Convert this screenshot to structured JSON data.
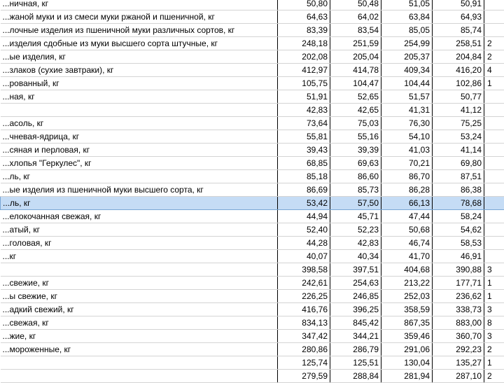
{
  "rows": [
    {
      "name": "...ничная, кг",
      "v1": "50,80",
      "v2": "50,48",
      "v3": "51,05",
      "v4": "50,91",
      "v5": ""
    },
    {
      "name": "...жаной муки и из смеси муки ржаной и пшеничной, кг",
      "v1": "64,63",
      "v2": "64,02",
      "v3": "63,84",
      "v4": "64,93",
      "v5": ""
    },
    {
      "name": "...лочные изделия из пшеничной муки различных сортов, кг",
      "v1": "83,39",
      "v2": "83,54",
      "v3": "85,05",
      "v4": "85,74",
      "v5": ""
    },
    {
      "name": "...изделия сдобные из муки высшего сорта штучные, кг",
      "v1": "248,18",
      "v2": "251,59",
      "v3": "254,99",
      "v4": "258,51",
      "v5": "2"
    },
    {
      "name": "...ые изделия, кг",
      "v1": "202,08",
      "v2": "205,04",
      "v3": "205,37",
      "v4": "204,84",
      "v5": "2"
    },
    {
      "name": "...злаков (сухие завтраки), кг",
      "v1": "412,97",
      "v2": "414,78",
      "v3": "409,34",
      "v4": "416,20",
      "v5": "4"
    },
    {
      "name": "...рованный, кг",
      "v1": "105,75",
      "v2": "104,47",
      "v3": "104,44",
      "v4": "102,86",
      "v5": "1"
    },
    {
      "name": "...ная, кг",
      "v1": "51,91",
      "v2": "52,65",
      "v3": "51,57",
      "v4": "50,77",
      "v5": ""
    },
    {
      "name": "",
      "v1": "42,83",
      "v2": "42,65",
      "v3": "41,31",
      "v4": "41,12",
      "v5": ""
    },
    {
      "name": "...асоль, кг",
      "v1": "73,64",
      "v2": "75,03",
      "v3": "76,30",
      "v4": "75,25",
      "v5": ""
    },
    {
      "name": "...чневая-ядрица, кг",
      "v1": "55,81",
      "v2": "55,16",
      "v3": "54,10",
      "v4": "53,24",
      "v5": ""
    },
    {
      "name": "...сяная и перловая, кг",
      "v1": "39,43",
      "v2": "39,39",
      "v3": "41,03",
      "v4": "41,14",
      "v5": ""
    },
    {
      "name": "...хлопья \"Геркулес\", кг",
      "v1": "68,85",
      "v2": "69,63",
      "v3": "70,21",
      "v4": "69,80",
      "v5": ""
    },
    {
      "name": "...ль, кг",
      "v1": "85,18",
      "v2": "86,60",
      "v3": "86,70",
      "v4": "87,51",
      "v5": ""
    },
    {
      "name": "...ые изделия из пшеничной муки высшего сорта, кг",
      "v1": "86,69",
      "v2": "85,73",
      "v3": "86,28",
      "v4": "86,38",
      "v5": ""
    },
    {
      "name": "...ль, кг",
      "v1": "53,42",
      "v2": "57,50",
      "v3": "66,13",
      "v4": "78,68",
      "v5": "",
      "selected": true
    },
    {
      "name": "...елокочанная свежая, кг",
      "v1": "44,94",
      "v2": "45,71",
      "v3": "47,44",
      "v4": "58,24",
      "v5": ""
    },
    {
      "name": "...атый, кг",
      "v1": "52,40",
      "v2": "52,23",
      "v3": "50,68",
      "v4": "54,62",
      "v5": ""
    },
    {
      "name": "...головая, кг",
      "v1": "44,28",
      "v2": "42,83",
      "v3": "46,74",
      "v4": "58,53",
      "v5": ""
    },
    {
      "name": "...кг",
      "v1": "40,07",
      "v2": "40,34",
      "v3": "41,70",
      "v4": "46,91",
      "v5": ""
    },
    {
      "name": "",
      "v1": "398,58",
      "v2": "397,51",
      "v3": "404,68",
      "v4": "390,88",
      "v5": "3"
    },
    {
      "name": "...свежие, кг",
      "v1": "242,61",
      "v2": "254,63",
      "v3": "213,22",
      "v4": "177,71",
      "v5": "1"
    },
    {
      "name": "...ы свежие, кг",
      "v1": "226,25",
      "v2": "246,85",
      "v3": "252,03",
      "v4": "236,62",
      "v5": "1"
    },
    {
      "name": "...адкий свежий, кг",
      "v1": "416,76",
      "v2": "396,25",
      "v3": "358,59",
      "v4": "338,73",
      "v5": "3"
    },
    {
      "name": "...свежая, кг",
      "v1": "834,13",
      "v2": "845,42",
      "v3": "867,35",
      "v4": "883,00",
      "v5": "8"
    },
    {
      "name": "...жие, кг",
      "v1": "347,42",
      "v2": "344,21",
      "v3": "359,46",
      "v4": "360,70",
      "v5": "3"
    },
    {
      "name": "...мороженные, кг",
      "v1": "280,86",
      "v2": "286,79",
      "v3": "291,06",
      "v4": "292,23",
      "v5": "2"
    },
    {
      "name": "",
      "v1": "125,74",
      "v2": "125,51",
      "v3": "130,04",
      "v4": "135,27",
      "v5": "1"
    },
    {
      "name": "",
      "v1": "279,59",
      "v2": "288,84",
      "v3": "281,94",
      "v4": "287,10",
      "v5": "2"
    }
  ]
}
